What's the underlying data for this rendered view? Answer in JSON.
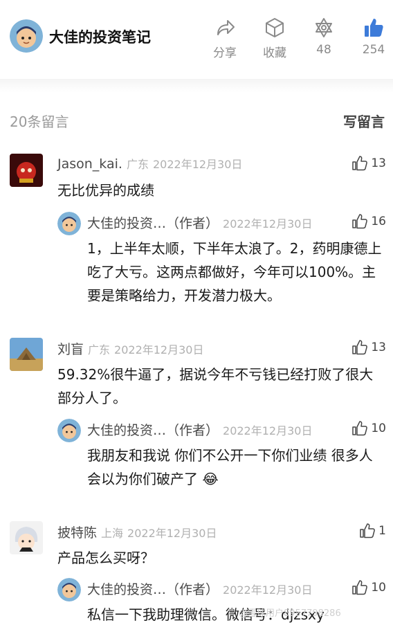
{
  "header": {
    "title": "大佳的投资笔记",
    "share_label": "分享",
    "collect_label": "收藏",
    "hex_count": "48",
    "like_count": "254"
  },
  "comments_bar": {
    "count_label": "20条留言",
    "write_label": "写留言"
  },
  "comments": [
    {
      "name": "Jason_kai.",
      "location": "广东",
      "date": "2022年12月30日",
      "likes": "13",
      "text": "无比优异的成绩",
      "reply": {
        "name": "大佳的投资…（作者）",
        "date": "2022年12月30日",
        "likes": "16",
        "text": "1，上半年太顺，下半年太浪了。2，药明康德上吃了大亏。这两点都做好，今年可以100%。主要是策略给力，开发潜力极大。"
      }
    },
    {
      "name": "刘盲",
      "location": "广东",
      "date": "2022年12月30日",
      "likes": "13",
      "text": "59.32%很牛逼了，据说今年不亏钱已经打败了很大部分人了。",
      "reply": {
        "name": "大佳的投资…（作者）",
        "date": "2022年12月30日",
        "likes": "10",
        "text": "我朋友和我说 你们不公开一下你们业绩 很多人会以为你们破产了 😂"
      }
    },
    {
      "name": "披特陈",
      "location": "上海",
      "date": "2022年12月30日",
      "likes": "1",
      "text": "产品怎么买呀？",
      "reply": {
        "name": "大佳的投资…（作者）",
        "date": "2022年12月30日",
        "likes": "10",
        "text": "私信一下我助理微信。微信号：djzsxy"
      }
    }
  ],
  "watermark": "@雪球用户8957798286"
}
